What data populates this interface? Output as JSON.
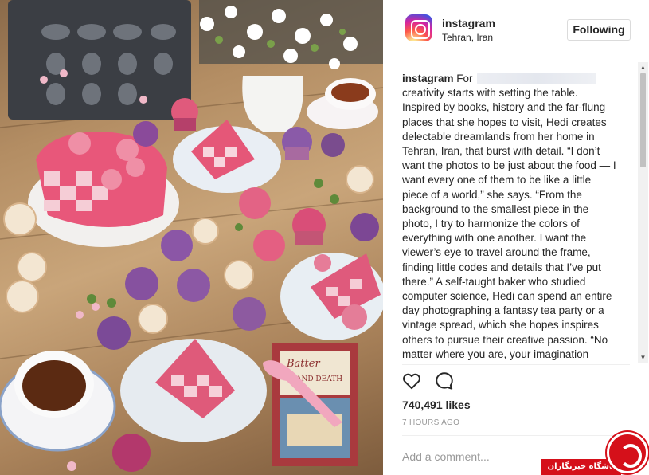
{
  "post": {
    "username": "instagram",
    "location": "Tehran, Iran",
    "follow_label": "Following",
    "caption_user": "instagram",
    "caption_text": "For [redacted] creativity starts with setting the table. Inspired by books, history and the far-flung places that she hopes to visit, Hedi creates delectable dreamlands from her home in Tehran, Iran, that burst with detail. “I don’t want the photos to be just about the food — I want every one of them to be like a little piece of a world,” she says. “From the background to the smallest piece in the photo, I try to harmonize the colors of everything with one another. I want the viewer’s eye to travel around the frame, finding little codes and details that I’ve put there.” A self-taught baker who studied computer science, Hedi can spend an entire day photographing a fantasy tea party or a vintage spread, which she hopes inspires others to pursue their creative passion. “No matter where you are, your imagination",
    "caption_first_word": "For",
    "caption_rest": "creativity starts with setting the table. Inspired by books, history and the far-flung places that she hopes to visit, Hedi creates delectable dreamlands from her home in Tehran, Iran, that burst with detail. “I don’t want the photos to be just about the food — I want every one of them to be like a little piece of a world,” she says. “From the background to the smallest piece in the photo, I try to harmonize the colors of everything with one another. I want the viewer’s eye to travel around the frame, finding little codes and details that I’ve put there.” A self-taught baker who studied computer science, Hedi can spend an entire day photographing a fantasy tea party or a vintage spread, which she hopes inspires others to pursue their creative passion. “No matter where you are, your imagination",
    "likes": "740,491 likes",
    "time": "7 HOURS AGO",
    "comment_placeholder": "Add a comment..."
  },
  "icons": {
    "like": "heart-outline-icon",
    "comment": "comment-bubble-icon",
    "scroll_up": "▲",
    "scroll_down": "▼"
  },
  "photo": {
    "book_title_line1": "Batter",
    "book_title_line2": "LAND DEATH"
  },
  "watermark": {
    "text": "باشگاه خبرنگاران"
  },
  "colors": {
    "accent_pink": "#e8577a",
    "text": "#262626",
    "muted": "#999999",
    "border": "#dbdbdb",
    "watermark_red": "#d5101a"
  }
}
